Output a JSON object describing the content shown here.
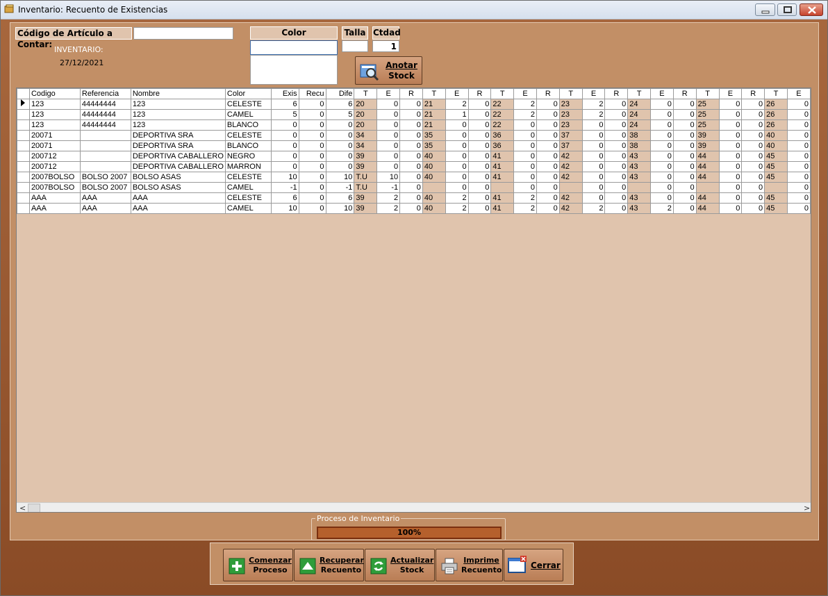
{
  "window": {
    "title": "Inventario: Recuento de Existencias"
  },
  "form": {
    "codigo_label": "Código de Artículo a Contar:",
    "codigo_value": "",
    "color_label": "Color",
    "color_value": "",
    "talla_label": "Talla",
    "talla_value": "",
    "ctdad_label": "Ctdad",
    "ctdad_value": "1",
    "inventario_label": "INVENTARIO:",
    "fecha": "27/12/2021",
    "anotar_line1": "Anotar",
    "anotar_line2": "Stock"
  },
  "grid": {
    "headers": [
      "Codigo",
      "Referencia",
      "Nombre",
      "Color",
      "Exis",
      "Recu",
      "Dife",
      "T",
      "E",
      "R",
      "T",
      "E",
      "R",
      "T",
      "E",
      "R",
      "T",
      "E",
      "R",
      "T",
      "E",
      "R",
      "T",
      "E",
      "R",
      "T",
      "E"
    ],
    "rows": [
      [
        "123",
        "44444444",
        "123",
        "CELESTE",
        "6",
        "0",
        "6",
        "20",
        "0",
        "0",
        "21",
        "2",
        "0",
        "22",
        "2",
        "0",
        "23",
        "2",
        "0",
        "24",
        "0",
        "0",
        "25",
        "0",
        "0",
        "26",
        "0"
      ],
      [
        "123",
        "44444444",
        "123",
        "CAMEL",
        "5",
        "0",
        "5",
        "20",
        "0",
        "0",
        "21",
        "1",
        "0",
        "22",
        "2",
        "0",
        "23",
        "2",
        "0",
        "24",
        "0",
        "0",
        "25",
        "0",
        "0",
        "26",
        "0"
      ],
      [
        "123",
        "44444444",
        "123",
        "BLANCO",
        "0",
        "0",
        "0",
        "20",
        "0",
        "0",
        "21",
        "0",
        "0",
        "22",
        "0",
        "0",
        "23",
        "0",
        "0",
        "24",
        "0",
        "0",
        "25",
        "0",
        "0",
        "26",
        "0"
      ],
      [
        "20071",
        "",
        "DEPORTIVA SRA",
        "CELESTE",
        "0",
        "0",
        "0",
        "34",
        "0",
        "0",
        "35",
        "0",
        "0",
        "36",
        "0",
        "0",
        "37",
        "0",
        "0",
        "38",
        "0",
        "0",
        "39",
        "0",
        "0",
        "40",
        "0"
      ],
      [
        "20071",
        "",
        "DEPORTIVA SRA",
        "BLANCO",
        "0",
        "0",
        "0",
        "34",
        "0",
        "0",
        "35",
        "0",
        "0",
        "36",
        "0",
        "0",
        "37",
        "0",
        "0",
        "38",
        "0",
        "0",
        "39",
        "0",
        "0",
        "40",
        "0"
      ],
      [
        "200712",
        "",
        "DEPORTIVA CABALLERO",
        "NEGRO",
        "0",
        "0",
        "0",
        "39",
        "0",
        "0",
        "40",
        "0",
        "0",
        "41",
        "0",
        "0",
        "42",
        "0",
        "0",
        "43",
        "0",
        "0",
        "44",
        "0",
        "0",
        "45",
        "0"
      ],
      [
        "200712",
        "",
        "DEPORTIVA CABALLERO",
        "MARRON",
        "0",
        "0",
        "0",
        "39",
        "0",
        "0",
        "40",
        "0",
        "0",
        "41",
        "0",
        "0",
        "42",
        "0",
        "0",
        "43",
        "0",
        "0",
        "44",
        "0",
        "0",
        "45",
        "0"
      ],
      [
        "2007BOLSO",
        "BOLSO 2007",
        "BOLSO ASAS",
        "CELESTE",
        "10",
        "0",
        "10",
        "T.U",
        "10",
        "0",
        "40",
        "0",
        "0",
        "41",
        "0",
        "0",
        "42",
        "0",
        "0",
        "43",
        "0",
        "0",
        "44",
        "0",
        "0",
        "45",
        "0"
      ],
      [
        "2007BOLSO",
        "BOLSO 2007",
        "BOLSO ASAS",
        "CAMEL",
        "-1",
        "0",
        "-1",
        "T.U",
        "-1",
        "0",
        "",
        "0",
        "0",
        "",
        "0",
        "0",
        "",
        "0",
        "0",
        "",
        "0",
        "0",
        "",
        "0",
        "0",
        "",
        "0"
      ],
      [
        "AAA",
        "AAA",
        "AAA",
        "CELESTE",
        "6",
        "0",
        "6",
        "39",
        "2",
        "0",
        "40",
        "2",
        "0",
        "41",
        "2",
        "0",
        "42",
        "0",
        "0",
        "43",
        "0",
        "0",
        "44",
        "0",
        "0",
        "45",
        "0"
      ],
      [
        "AAA",
        "AAA",
        "AAA",
        "CAMEL",
        "10",
        "0",
        "10",
        "39",
        "2",
        "0",
        "40",
        "2",
        "0",
        "41",
        "2",
        "0",
        "42",
        "2",
        "0",
        "43",
        "2",
        "0",
        "44",
        "0",
        "0",
        "45",
        "0"
      ]
    ]
  },
  "progress": {
    "label": "Proceso de Inventario",
    "value_text": "100%",
    "value": 1.0
  },
  "toolbar": {
    "comenzar": [
      "Comenzar",
      "Proceso"
    ],
    "recuperar": [
      "Recuperar",
      "Recuento"
    ],
    "actualizar": [
      "Actualizar",
      "Stock"
    ],
    "imprime": [
      "Imprime",
      "Recuento"
    ],
    "cerrar": "Cerrar"
  },
  "icons": [
    "app-icon",
    "minimize-icon",
    "maximize-icon",
    "close-icon",
    "search-icon",
    "row-pointer-icon",
    "plus-icon",
    "up-arrow-icon",
    "refresh-icon",
    "printer-icon",
    "window-close-icon",
    "scroll-left-icon",
    "scroll-right-icon"
  ],
  "colors": {
    "frame": "#8a4b26",
    "panel": "#c28f66",
    "grid_bg": "#e0c4ad",
    "progress": "#b5602c"
  }
}
